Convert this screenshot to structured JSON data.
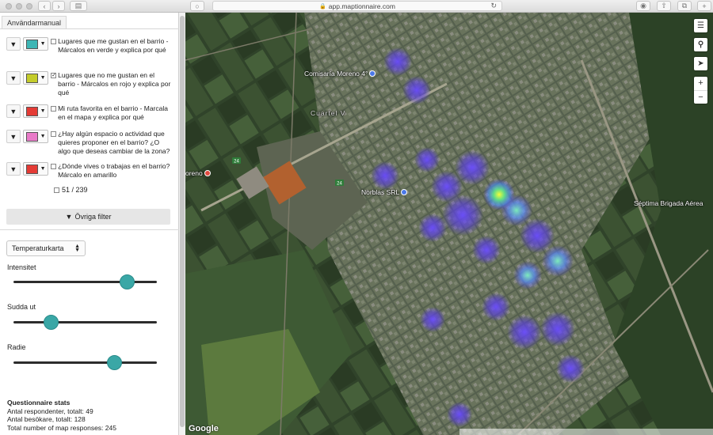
{
  "browser": {
    "url": "app.maptionnaire.com"
  },
  "panel": {
    "manual_tab": "Användarmanual",
    "layers": [
      {
        "text": "Lugares que me gustan en el barrio - Márcalos en verde y explica por qué",
        "color": "#3db6b5",
        "checked": false
      },
      {
        "text": "Lugares que no me gustan en el barrio - Márcalos en rojo y explica por qué",
        "color": "#c4cc2b",
        "checked": true
      },
      {
        "text": "Mi ruta favorita en el barrio - Marcala en el mapa y explica por qué",
        "color": "#e43b35",
        "checked": false
      },
      {
        "text": "¿Hay algún espacio o actividad que quieres proponer en el barrio? ¿O algo que deseas cambiar de la zona?",
        "color": "#e97ac8",
        "checked": false
      },
      {
        "text": "¿Dónde vives o trabajas en el barrio? Márcalo en amarillo",
        "color": "#e43b35",
        "checked": false
      }
    ],
    "counter": "51 / 239",
    "other_filters": "Övriga filter",
    "view_select": "Temperaturkarta",
    "sliders": [
      {
        "label": "Intensitet",
        "value": 0.79
      },
      {
        "label": "Sudda ut",
        "value": 0.26
      },
      {
        "label": "Radie",
        "value": 0.7
      }
    ],
    "stats": {
      "title": "Questionnaire stats",
      "respondents": "Antal respondenter, totalt: 49",
      "visitors": "Antal besökare, totalt: 128",
      "map_responses": "Total number of map responses: 245"
    }
  },
  "map": {
    "labels": {
      "comisaria": "Comisaría Moreno 4°",
      "cuartel": "Cuartel V",
      "moreno": "oreno",
      "norblas": "Norblas SRL",
      "brigada": "Séptima Brigada Aérea"
    },
    "route_badge": "24",
    "provider": "Google",
    "tools": {
      "layers": "layers-icon",
      "search": "search-icon",
      "locate": "locate-icon",
      "zoom_in": "+",
      "zoom_out": "−"
    }
  }
}
